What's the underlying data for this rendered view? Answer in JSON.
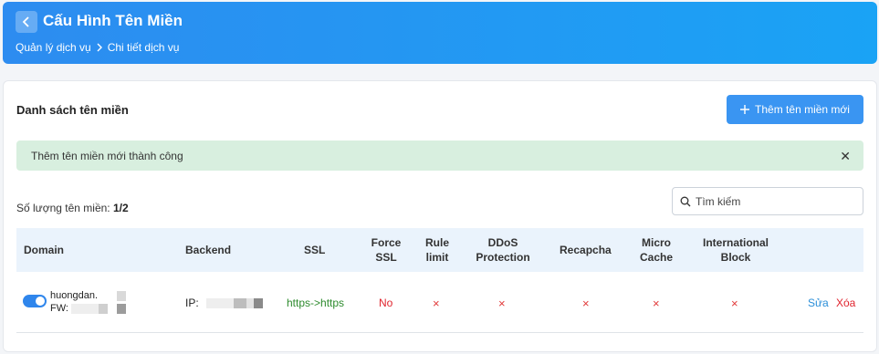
{
  "header": {
    "title": "Cấu Hình Tên Miền",
    "breadcrumb": [
      "Quản lý dịch vụ",
      "Chi tiết dịch vụ"
    ]
  },
  "panel": {
    "list_title": "Danh sách tên miền",
    "add_button": "Thêm tên miền mới",
    "alert": "Thêm tên miền mới thành công",
    "count_label": "Số lượng tên miền:",
    "count_value": "1/2",
    "search_placeholder": "Tìm kiếm"
  },
  "table": {
    "columns": [
      "Domain",
      "Backend",
      "SSL",
      "Force SSL",
      "Rule limit",
      "DDoS Protection",
      "Recapcha",
      "Micro Cache",
      "International Block"
    ],
    "rows": [
      {
        "domain": "huongdan.",
        "fw_label": "FW:",
        "ip_label": "IP:",
        "ssl": "https->https",
        "force_ssl": "No",
        "rule_limit": "×",
        "ddos": "×",
        "recapcha": "×",
        "micro_cache": "×",
        "intl_block": "×",
        "enabled": true,
        "edit": "Sửa",
        "delete": "Xóa"
      }
    ]
  },
  "colors": {
    "accent": "#3a95f2",
    "success_bg": "#d8efdf",
    "ssl_green": "#2e8b2e",
    "danger": "#e0242e"
  },
  "icons": {
    "back": "chevron-left-icon",
    "breadcrumb_sep": "chevron-right-icon",
    "add": "plus-icon",
    "search": "search-icon",
    "close": "close-icon"
  }
}
